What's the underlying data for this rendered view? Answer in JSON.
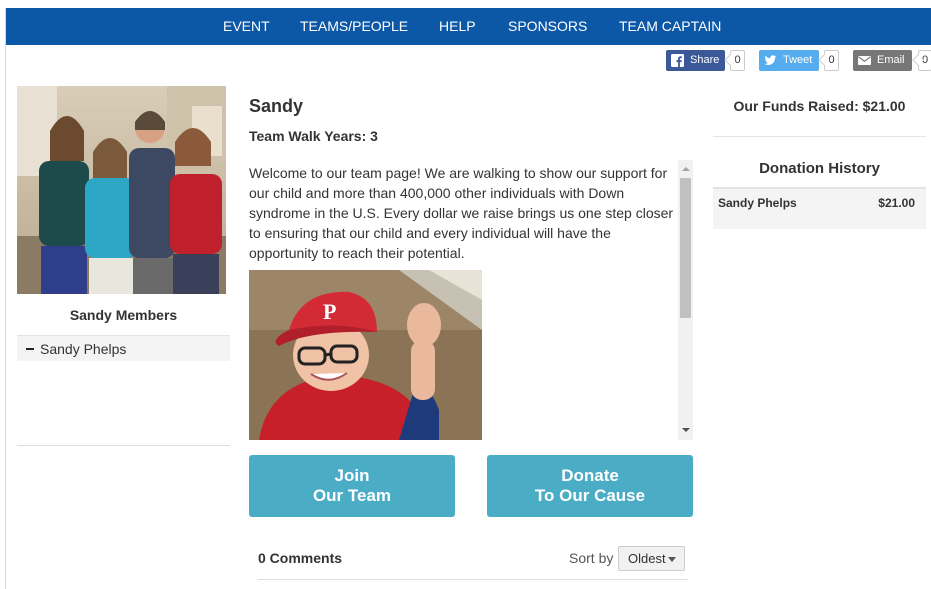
{
  "nav": {
    "items": [
      {
        "label": "EVENT"
      },
      {
        "label": "TEAMS/PEOPLE"
      },
      {
        "label": "HELP"
      },
      {
        "label": "SPONSORS"
      },
      {
        "label": "TEAM CAPTAIN"
      }
    ]
  },
  "share": {
    "facebook": {
      "label": "Share",
      "count": "0",
      "icon": "facebook-icon"
    },
    "twitter": {
      "label": "Tweet",
      "count": "0",
      "icon": "twitter-icon"
    },
    "email": {
      "label": "Email",
      "count": "0",
      "icon": "envelope-icon"
    }
  },
  "team": {
    "name": "Sandy",
    "walk_years": "Team Walk Years: 3",
    "story": "Welcome to our team page!  We are walking to show our support for our child and more than 400,000 other individuals with Down syndrome in the U.S.  Every dollar we raise brings us one step closer to ensuring that our child and every individual will have the opportunity to reach their potential."
  },
  "members": {
    "title": "Sandy Members",
    "list": [
      {
        "name": "Sandy Phelps"
      }
    ]
  },
  "cta": {
    "join_line1": "Join",
    "join_line2": "Our Team",
    "donate_line1": "Donate",
    "donate_line2": "To Our Cause",
    "color": "#4bacc6"
  },
  "comments": {
    "count_label": "0 Comments",
    "sort_label": "Sort by",
    "sort_value": "Oldest"
  },
  "funds": {
    "raised_label": "Our Funds Raised: $21.00"
  },
  "donations": {
    "title": "Donation History",
    "rows": [
      {
        "name": "Sandy Phelps",
        "amount": "$21.00"
      }
    ]
  },
  "colors": {
    "nav_bg": "#0d57a7",
    "facebook": "#3b5998",
    "twitter": "#55acee",
    "email": "#777777"
  }
}
